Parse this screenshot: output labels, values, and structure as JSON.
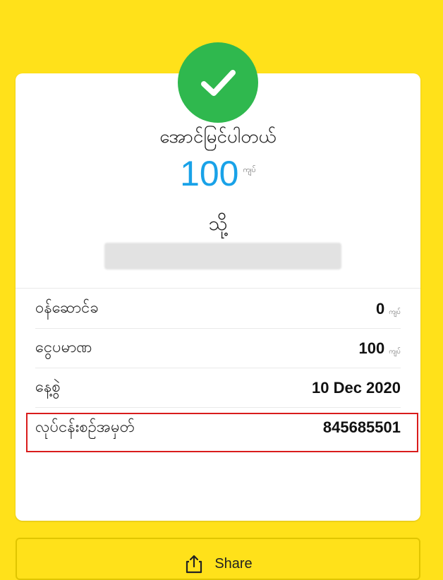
{
  "colors": {
    "background": "#FFE11A",
    "success": "#2FB84E",
    "amount": "#19A2E8",
    "highlight": "#D91C1C"
  },
  "icons": {
    "success": "checkmark-icon",
    "share": "share-icon"
  },
  "receipt": {
    "status": "အောင်မြင်ပါတယ်",
    "amount": "100",
    "amount_unit": "ကျပ်",
    "to_label": "သို့",
    "details": [
      {
        "label": "ဝန်ဆောင်ခ",
        "value": "0",
        "unit": "ကျပ်"
      },
      {
        "label": "ငွေပမာဏ",
        "value": "100",
        "unit": "ကျပ်"
      },
      {
        "label": "နေ့စွဲ",
        "value": "10 Dec 2020"
      },
      {
        "label": "လုပ်ငန်းစဉ်အမှတ်",
        "value": "845685501"
      }
    ]
  },
  "share": {
    "label": "Share"
  }
}
